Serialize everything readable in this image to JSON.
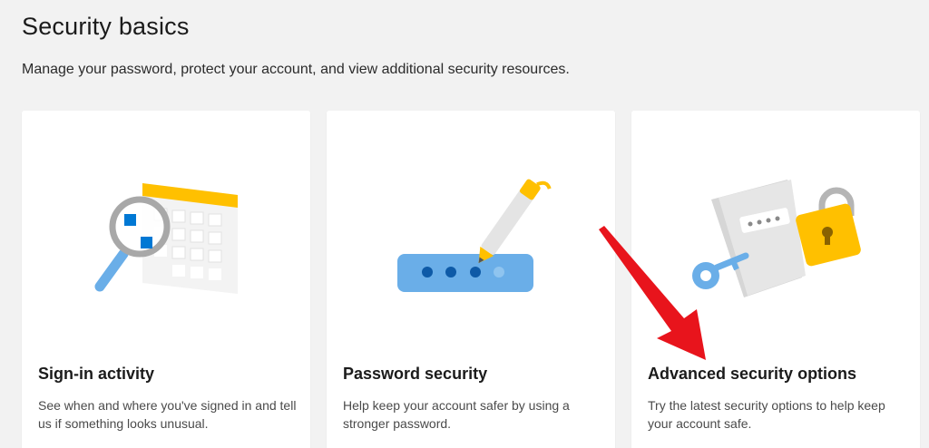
{
  "header": {
    "title": "Security basics",
    "subtitle": "Manage your password, protect your account, and view additional security resources."
  },
  "cards": [
    {
      "title": "Sign-in activity",
      "description": "See when and where you've signed in and tell us if something looks unusual.",
      "icon": "calendar-magnifier-icon"
    },
    {
      "title": "Password security",
      "description": "Help keep your account safer by using a stronger password.",
      "icon": "password-pen-icon"
    },
    {
      "title": "Advanced security options",
      "description": "Try the latest security options to help keep your account safe.",
      "icon": "notebook-key-lock-icon"
    }
  ],
  "colors": {
    "background": "#f2f2f2",
    "card": "#ffffff",
    "accent_blue": "#0078d4",
    "illustration_blue": "#6aaee8",
    "illustration_yellow": "#ffc000",
    "annotation_arrow": "#e8141c"
  }
}
